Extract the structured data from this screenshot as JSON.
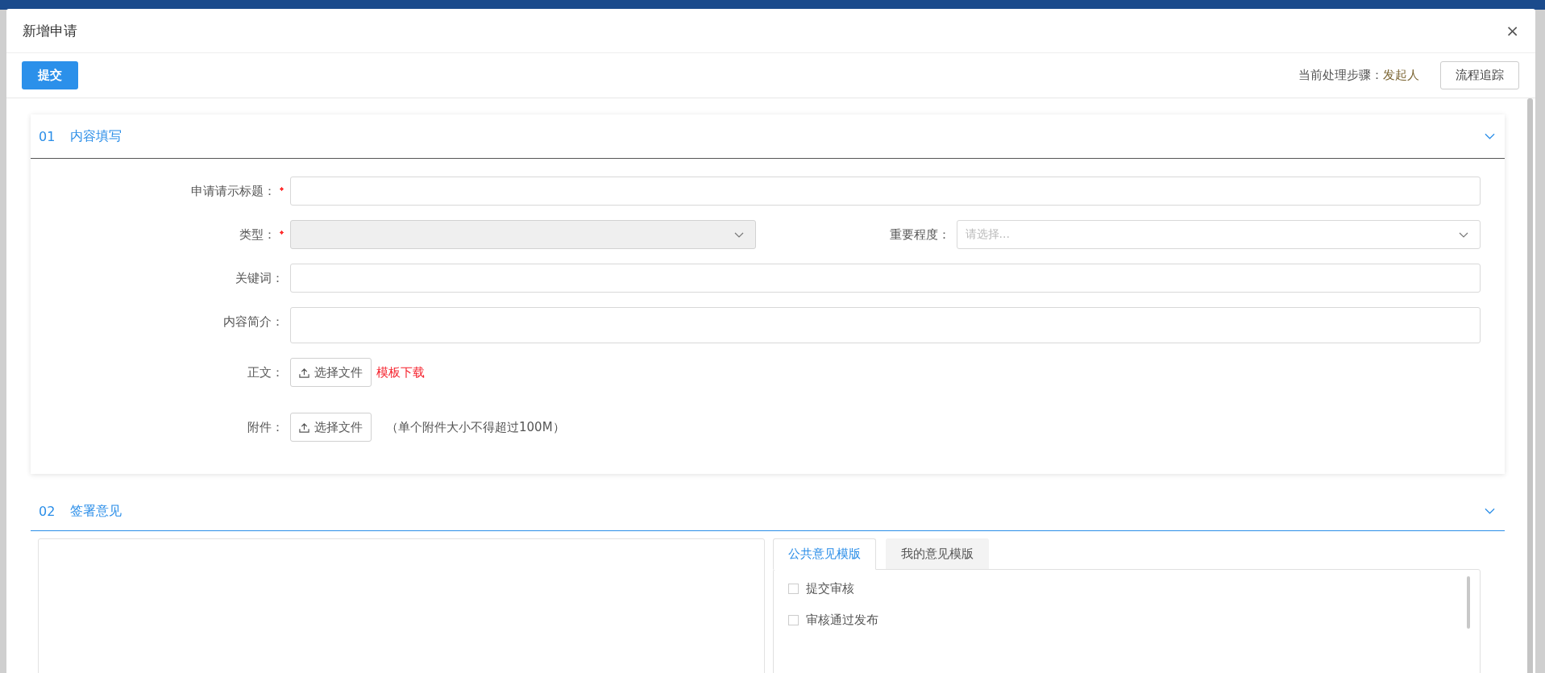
{
  "dialog": {
    "title": "新增申请",
    "close": "×"
  },
  "toolbar": {
    "submit": "提交",
    "step_label": "当前处理步骤：",
    "step_value": "发起人",
    "trace_button": "流程追踪"
  },
  "content_section": {
    "number": "01",
    "title": "内容填写",
    "rows": [
      {
        "fields": [
          {
            "kind": "text",
            "label": "申请请示标题：",
            "required": true
          }
        ]
      },
      {
        "fields": [
          {
            "kind": "select",
            "label": "类型：",
            "required": true,
            "disabled": true
          },
          {
            "kind": "select",
            "label": "重要程度：",
            "required": false,
            "disabled": false,
            "placeholder": "请选择..."
          }
        ]
      },
      {
        "fields": [
          {
            "kind": "text",
            "label": "关键词：",
            "required": false
          }
        ]
      },
      {
        "fields": [
          {
            "kind": "textarea",
            "label": "内容简介：",
            "required": false
          }
        ]
      },
      {
        "fields": [
          {
            "kind": "upload",
            "label": "正文：",
            "required": false,
            "button": "选择文件",
            "link": "模板下载"
          }
        ]
      },
      {
        "fields": [
          {
            "kind": "upload",
            "label": "附件：",
            "required": false,
            "button": "选择文件",
            "note": "（单个附件大小不得超过100M）"
          }
        ]
      }
    ]
  },
  "opinion_section": {
    "number": "02",
    "title": "签署意见",
    "tabs": [
      {
        "label": "公共意见模版",
        "selected": true
      },
      {
        "label": "我的意见模版",
        "selected": false
      }
    ],
    "options": [
      {
        "label": "提交审核",
        "checked": false
      },
      {
        "label": "审核通过发布",
        "checked": false
      }
    ]
  }
}
